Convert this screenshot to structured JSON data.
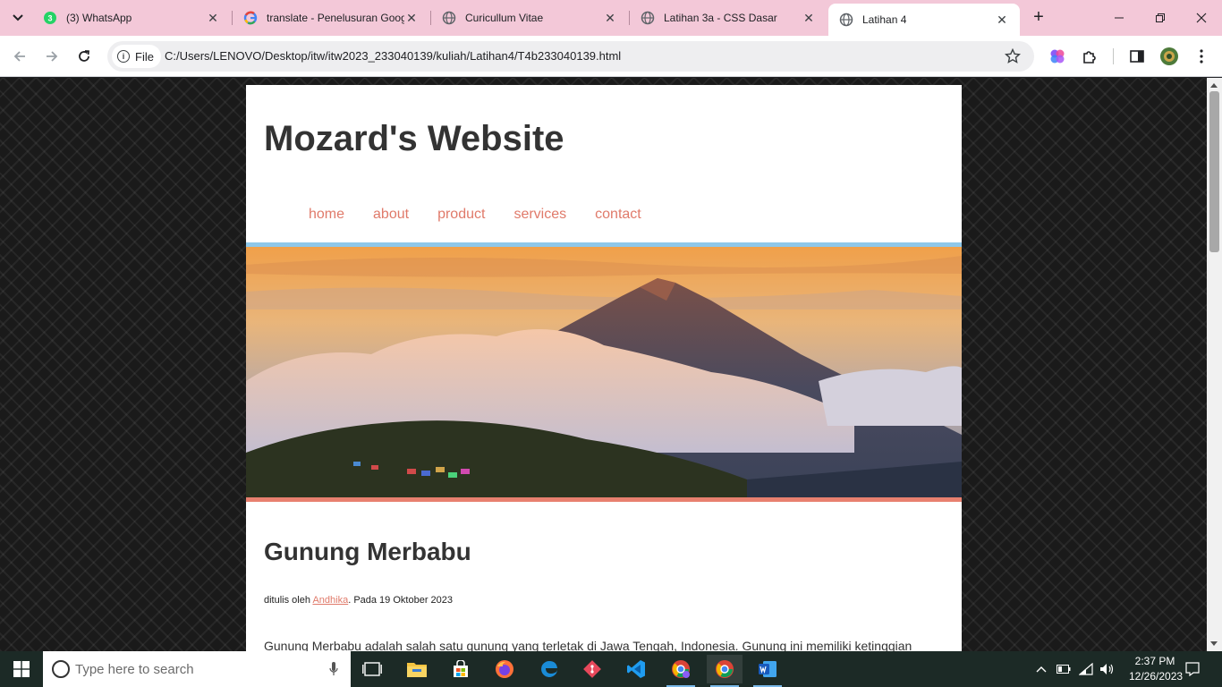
{
  "browser": {
    "tabs": [
      {
        "title": "(3) WhatsApp",
        "icon": "whatsapp-icon",
        "active": false
      },
      {
        "title": "translate - Penelusuran Goog",
        "icon": "google-icon",
        "active": false
      },
      {
        "title": "Curicullum Vitae",
        "icon": "globe-icon",
        "active": false
      },
      {
        "title": "Latihan 3a - CSS Dasar",
        "icon": "globe-icon",
        "active": false
      },
      {
        "title": "Latihan 4",
        "icon": "globe-icon",
        "active": true
      }
    ],
    "whatsapp_badge": "3",
    "address": {
      "scheme_label": "File",
      "url": "C:/Users/LENOVO/Desktop/itw/itw2023_233040139/kuliah/Latihan4/T4b233040139.html"
    }
  },
  "page": {
    "site_title": "Mozard's Website",
    "menu": [
      "home",
      "about",
      "product",
      "services",
      "contact"
    ],
    "article": {
      "title": "Gunung Merbabu",
      "meta_prefix": "ditulis oleh ",
      "author": "Andhika",
      "meta_suffix": ". Pada 19 Oktober 2023",
      "body": "Gunung Merbabu adalah salah satu gunung yang terletak di Jawa Tengah, Indonesia. Gunung ini memiliki ketinggian"
    },
    "colors": {
      "link": "#e07a6a",
      "hero_top_border": "#8ec8ea",
      "hero_bottom_border": "#e8806f"
    }
  },
  "taskbar": {
    "search_placeholder": "Type here to search",
    "apps": [
      "task-view-icon",
      "file-explorer-icon",
      "microsoft-store-icon",
      "firefox-icon",
      "edge-icon",
      "git-icon",
      "vscode-icon",
      "chrome-profile-icon",
      "chrome-icon",
      "word-icon"
    ],
    "clock": {
      "time": "2:37 PM",
      "date": "12/26/2023"
    }
  }
}
